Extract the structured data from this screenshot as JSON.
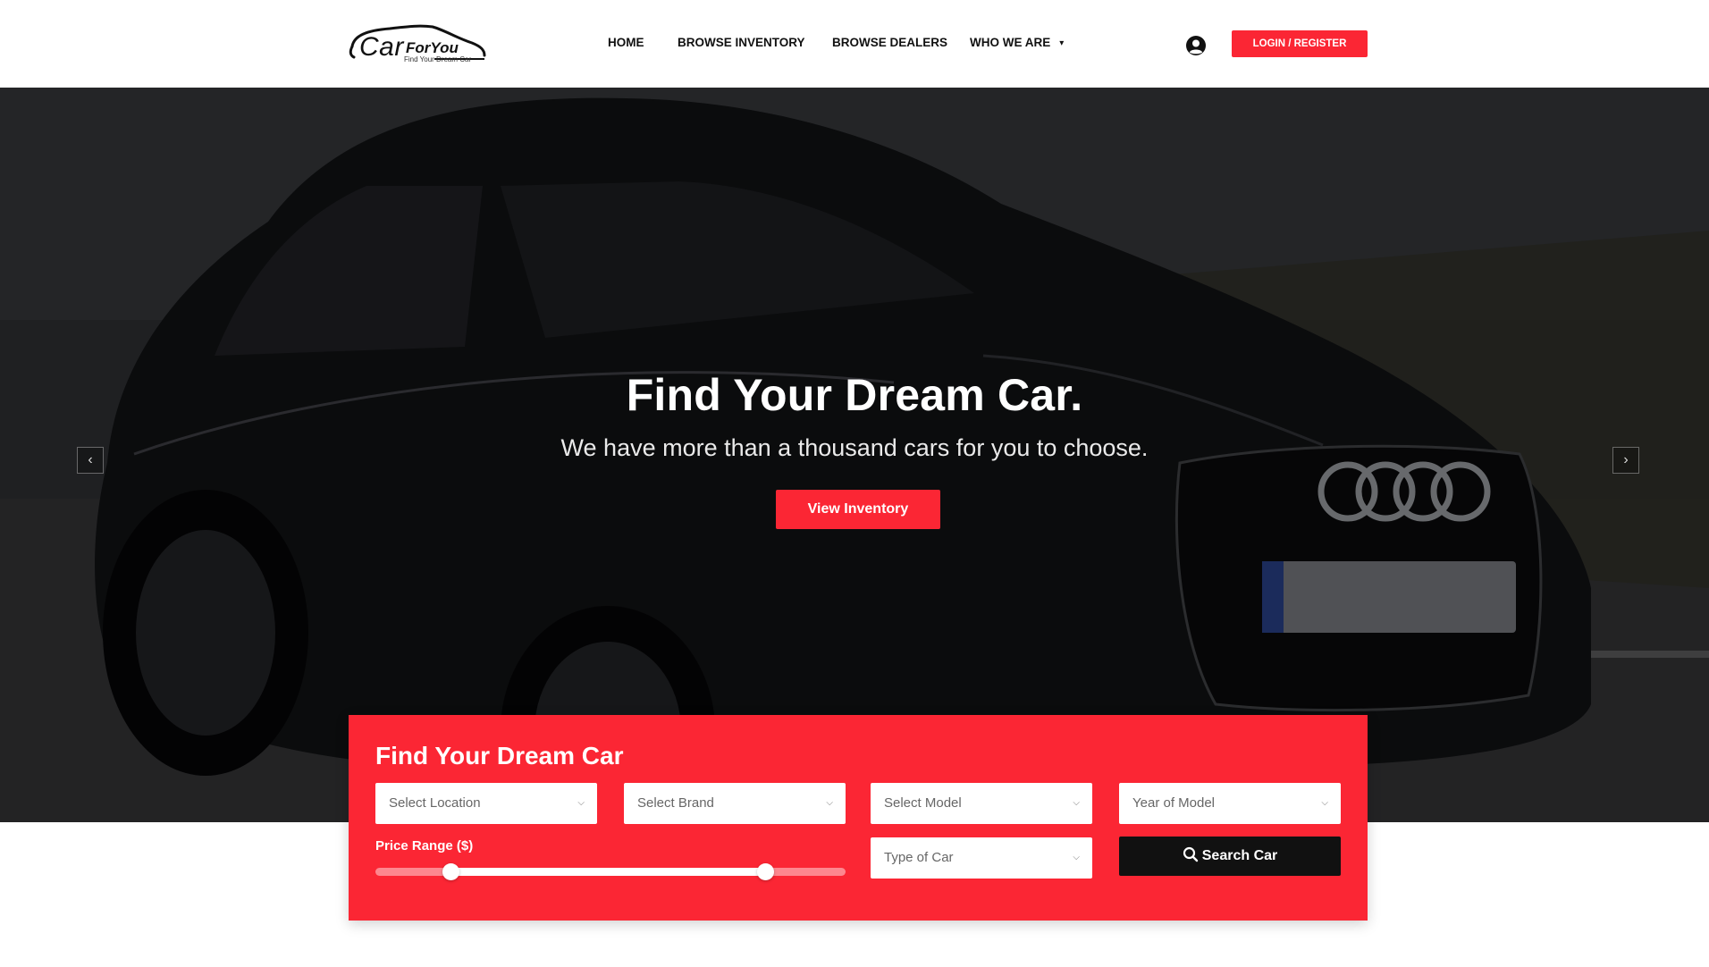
{
  "brand": {
    "name_main": "Car",
    "name_accent": "ForYou",
    "tagline": "Find Your Dream Car"
  },
  "nav": {
    "items": [
      {
        "label": "HOME"
      },
      {
        "label": "BROWSE INVENTORY"
      },
      {
        "label": "BROWSE DEALERS"
      },
      {
        "label": "WHO WE ARE"
      }
    ],
    "login_label": "LOGIN / REGISTER"
  },
  "hero": {
    "title": "Find Your Dream Car.",
    "subtitle": "We have more than a thousand cars for you to choose.",
    "cta_label": "View Inventory",
    "prev_arrow": "‹",
    "next_arrow": "›"
  },
  "search": {
    "title": "Find Your Dream Car",
    "location_placeholder": "Select Location",
    "brand_placeholder": "Select Brand",
    "model_placeholder": "Select Model",
    "year_placeholder": "Year of Model",
    "type_placeholder": "Type of Car",
    "price_label": "Price Range ($)",
    "price_range_fraction": {
      "low": 0.16,
      "high": 0.83
    },
    "button_label": "Search Car",
    "dropdown_glyph": "⌄"
  },
  "colors": {
    "accent": "#fb2634",
    "dark_button": "#111111",
    "hero_bg": "#2b2c2f"
  },
  "icons": {
    "user": "user-circle-icon",
    "search": "magnifier-icon",
    "chevron": "chevron-down-icon"
  }
}
